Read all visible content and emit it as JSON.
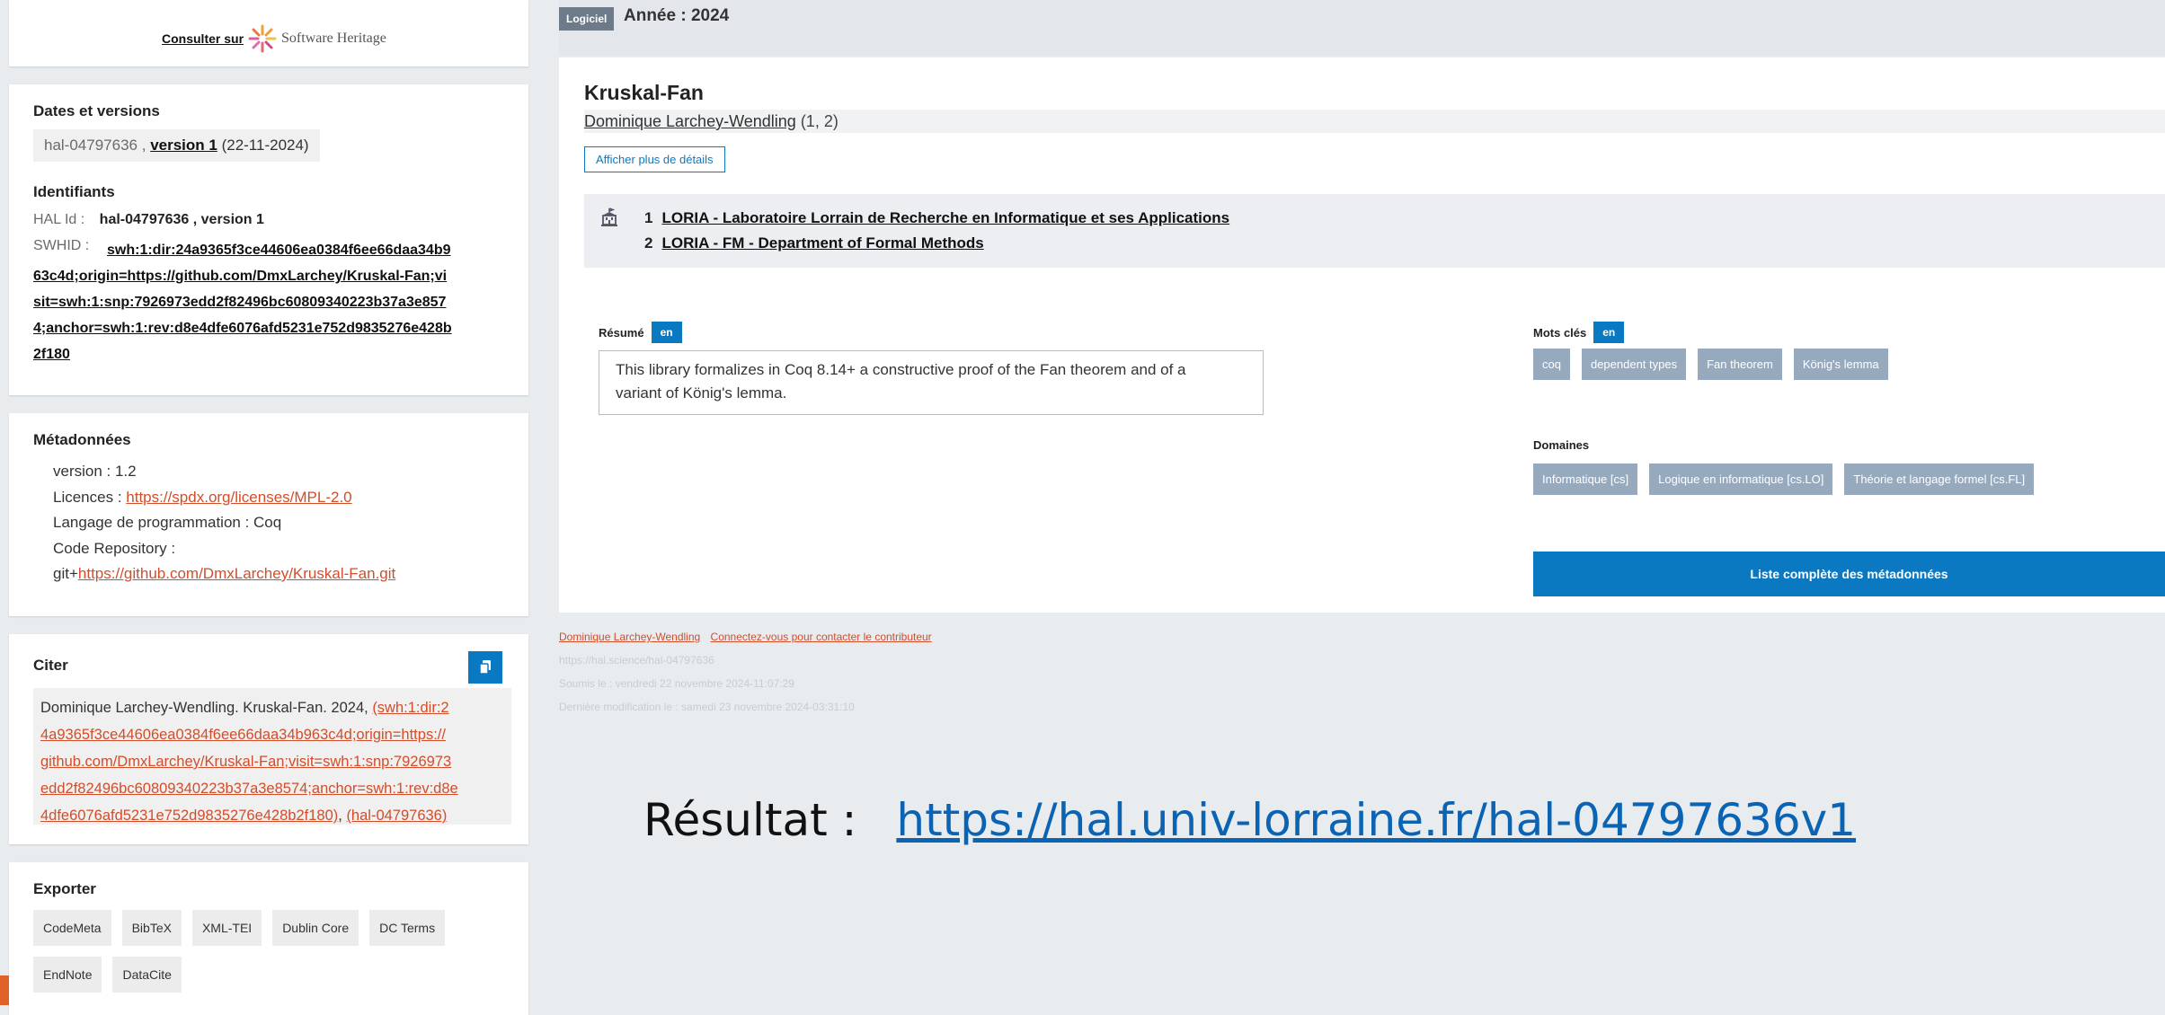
{
  "swh": {
    "prefix": "Consulter sur",
    "name": "Software Heritage"
  },
  "dates": {
    "title": "Dates et versions",
    "id": "hal-04797636",
    "separator": ",",
    "version_link": "version 1",
    "date": "(22-11-2024)"
  },
  "ids": {
    "title": "Identifiants",
    "hal_label": "HAL Id :",
    "hal_value": "hal-04797636 , version 1",
    "swhid_label": "SWHID :",
    "swhid_lines": [
      "swh:1:dir:24a9365f3ce44606ea0384f6ee66daa34b9",
      "63c4d;origin=https://github.com/DmxLarchey/Kruskal-Fan;vi",
      "sit=swh:1:snp:7926973edd2f82496bc60809340223b37a3e857",
      "4;anchor=swh:1:rev:d8e4dfe6076afd5231e752d9835276e428b",
      "2f180"
    ]
  },
  "meta": {
    "title": "Métadonnées",
    "version": "version : 1.2",
    "licences_label": "Licences :",
    "licences_link": "https://spdx.org/licenses/MPL-2.0",
    "langage": "Langage de programmation : Coq",
    "repo_label": "Code Repository :",
    "repo_prefix": "git+",
    "repo_link": "https://github.com/DmxLarchey/Kruskal-Fan.git"
  },
  "cite": {
    "title": "Citer",
    "text": "Dominique Larchey-Wendling. Kruskal-Fan. 2024,",
    "link_lines": [
      "(swh:1:dir:2",
      "4a9365f3ce44606ea0384f6ee66daa34b963c4d;origin=https://",
      "github.com/DmxLarchey/Kruskal-Fan;visit=swh:1:snp:7926973",
      "edd2f82496bc60809340223b37a3e8574;anchor=swh:1:rev:d8e",
      "4dfe6076afd5231e752d9835276e428b2f180)"
    ],
    "hal_link": "(hal-04797636)"
  },
  "export": {
    "title": "Exporter",
    "buttons_row1": [
      "CodeMeta",
      "BibTeX",
      "XML-TEI",
      "Dublin Core",
      "DC Terms"
    ],
    "buttons_row2": [
      "EndNote",
      "DataCite"
    ]
  },
  "header": {
    "type_badge": "Logiciel",
    "year": "Année : 2024"
  },
  "main": {
    "title": "Kruskal-Fan",
    "author": "Dominique Larchey-Wendling",
    "author_aff": "(1, 2)",
    "details_button": "Afficher plus de détails",
    "affiliations": [
      {
        "num": "1",
        "name": "LORIA - Laboratoire Lorrain de Recherche en Informatique et ses Applications"
      },
      {
        "num": "2",
        "name": "LORIA - FM - Department of Formal Methods"
      }
    ],
    "resume_label": "Résumé",
    "resume_lang": "en",
    "abstract_line1": "This library formalizes in Coq 8.14+ a constructive proof of the Fan theorem and of a",
    "abstract_line2": "variant of König's lemma.",
    "keywords_label": "Mots clés",
    "keywords_lang": "en",
    "keywords": [
      "coq",
      "dependent types",
      "Fan theorem",
      "König's lemma"
    ],
    "domains_label": "Domaines",
    "domains": [
      "Informatique [cs]",
      "Logique en informatique [cs.LO]",
      "Théorie et langage formel [cs.FL]"
    ],
    "full_meta_button": "Liste complète des métadonnées"
  },
  "footer": {
    "author_link": "Dominique Larchey-Wendling",
    "contact_link": "Connectez-vous pour contacter le contributeur",
    "url": "https://hal.science/hal-04797636",
    "submitted": "Soumis le : vendredi 22 novembre 2024-11:07:29",
    "modified": "Dernière modification le : samedi 23 novembre 2024-03:31:10"
  },
  "result": {
    "label": "Résultat :",
    "url": "https://hal.univ-lorraine.fr/hal-04797636v1"
  },
  "colors": {
    "brand_blue": "#0b79c1",
    "link_red": "#d24d2a",
    "tag_grey": "#97aabd",
    "badge_slate": "#6c7a89"
  },
  "icons": {
    "swh_logo": "software-heritage-logo",
    "copy": "copy-icon",
    "institution": "institution-icon"
  }
}
